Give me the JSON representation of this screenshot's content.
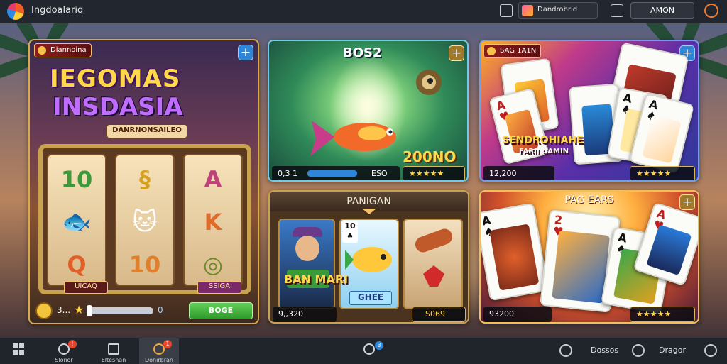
{
  "app": {
    "title": "Ingdoalarid"
  },
  "topbar": {
    "search_text": "Dandrobrid",
    "square_label": "",
    "account_button": "AMON"
  },
  "cards": {
    "slot": {
      "badge": "Diannoina",
      "title_line1": "IEGOMAS",
      "title_line2": "INSDASIA",
      "subtitle": "DANRNONSAILEO",
      "reel_symbols": [
        [
          "10",
          "🐟",
          "Q"
        ],
        [
          "§",
          "🐱",
          "10"
        ],
        [
          "A",
          "K",
          "◎"
        ]
      ],
      "reel_labels": [
        "UICAQ",
        "SSIGA"
      ],
      "coin_value": "3...",
      "slider_value": "0",
      "play_button": "BOGE"
    },
    "fishing": {
      "score_top": "BOS2",
      "score_bottom": "200NO",
      "balance": "0,3 1",
      "amount": "ESO",
      "rating": "★★★★★"
    },
    "poker": {
      "badge": "SAG 1A1N",
      "banner": "SENDROHIAHE",
      "banner_sub": "FARII  GAMIN",
      "balance": "12,200",
      "rating": "★★★★★"
    },
    "panigan": {
      "header": "PANIGAN",
      "panel2_title": "BAN MARI",
      "panel3_title": "GHEE",
      "balance": "9,,320",
      "amount": "S069"
    },
    "pagears": {
      "header": "PAG EARS",
      "balance": "93200",
      "rating": "★★★★★"
    }
  },
  "taskbar": {
    "items": [
      {
        "label": "",
        "badge": ""
      },
      {
        "label": "Slonor",
        "badge": "!"
      },
      {
        "label": "Eltesnan",
        "badge": ""
      },
      {
        "label": "Donirbran",
        "badge": "1"
      }
    ],
    "center_badge": "3",
    "right_items": [
      "Dossos",
      "Dragor"
    ]
  },
  "colors": {
    "topbar": "#22262e",
    "accent_blue": "#2f86d8",
    "accent_gold": "#d9a94a",
    "green_button": "#3fb03a"
  }
}
